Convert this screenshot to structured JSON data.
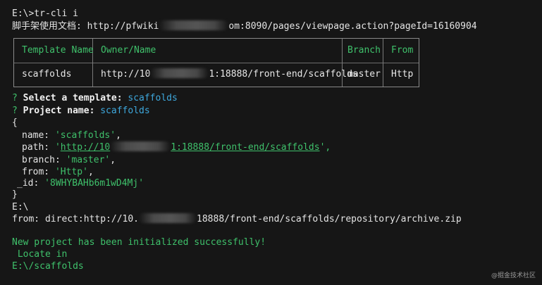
{
  "terminal": {
    "line1": "E:\\>tr-cli i",
    "doc_label": "脚手架使用文档:",
    "doc_url_prefix": "http://pfwiki",
    "doc_url_suffix": "om:8090/pages/viewpage.action?pageId=16160904"
  },
  "table": {
    "headers": {
      "template_name": "Template Name",
      "owner_name": "Owner/Name",
      "branch": "Branch",
      "from": "From"
    },
    "row": {
      "template_name": "scaffolds",
      "owner_prefix": "http://10",
      "owner_suffix": "1:18888/front-end/scaffolds",
      "branch": "master",
      "from": "Http"
    }
  },
  "prompts": {
    "mark": "?",
    "select_label": "Select a template:",
    "select_value": "scaffolds",
    "name_label": "Project name:",
    "name_value": "scaffolds"
  },
  "object": {
    "open": "{",
    "close": "}",
    "name_key": "name:",
    "name_val": "'scaffolds'",
    "path_key": "path:",
    "path_quote": "'",
    "path_prefix": "http://10",
    "path_suffix": "1:18888/front-end/scaffolds",
    "path_end": "',",
    "branch_key": "branch:",
    "branch_val": "'master'",
    "from_key": "from:",
    "from_val": "'Http'",
    "id_key": "_id:",
    "id_val": "'8WHYBAHb6m1wD4Mj'",
    "comma": ","
  },
  "after": {
    "drive": "E:\\",
    "from_prefix": "from: direct:http://10.",
    "from_suffix": "18888/front-end/scaffolds/repository/archive.zip",
    "success": "New project has been initialized successfully!",
    "locate": " Locate in",
    "target": "E:\\/scaffolds"
  },
  "watermark": "@掘金技术社区",
  "colors": {
    "background": "#161616",
    "accent_green": "#3fc16b",
    "accent_blue": "#3ea8dd"
  }
}
